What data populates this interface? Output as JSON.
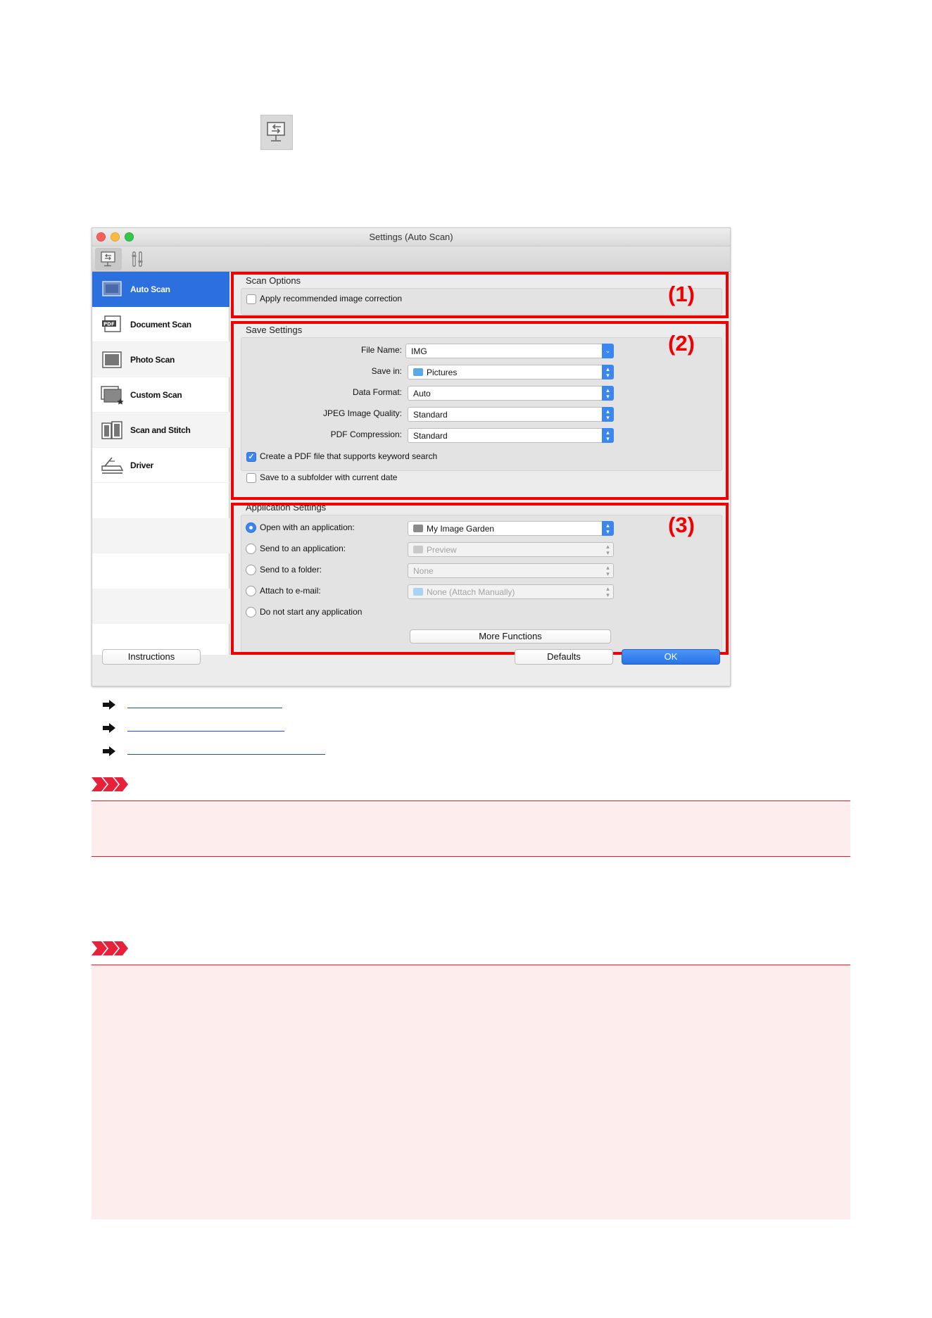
{
  "window": {
    "title": "Settings (Auto Scan)"
  },
  "sidebar": {
    "items": [
      {
        "label": "Auto Scan"
      },
      {
        "label": "Document Scan"
      },
      {
        "label": "Photo Scan"
      },
      {
        "label": "Custom Scan"
      },
      {
        "label": "Scan and Stitch"
      },
      {
        "label": "Driver"
      }
    ]
  },
  "scan_options": {
    "title": "Scan Options",
    "apply_correction_label": "Apply recommended image correction",
    "apply_correction_checked": false,
    "annotation": "(1)"
  },
  "save_settings": {
    "title": "Save Settings",
    "annotation": "(2)",
    "file_name_label": "File Name:",
    "file_name_value": "IMG",
    "save_in_label": "Save in:",
    "save_in_value": "Pictures",
    "data_format_label": "Data Format:",
    "data_format_value": "Auto",
    "jpeg_quality_label": "JPEG Image Quality:",
    "jpeg_quality_value": "Standard",
    "pdf_compression_label": "PDF Compression:",
    "pdf_compression_value": "Standard",
    "keyword_pdf_label": "Create a PDF file that supports keyword search",
    "keyword_pdf_checked": true,
    "subfolder_label": "Save to a subfolder with current date",
    "subfolder_checked": false
  },
  "application_settings": {
    "title": "Application Settings",
    "annotation": "(3)",
    "open_app_label": "Open with an application:",
    "open_app_value": "My Image Garden",
    "send_app_label": "Send to an application:",
    "send_app_value": "Preview",
    "send_folder_label": "Send to a folder:",
    "send_folder_value": "None",
    "attach_email_label": "Attach to e-mail:",
    "attach_email_value": "None (Attach Manually)",
    "no_app_label": "Do not start any application",
    "selected": "Open with an application:",
    "more_functions_label": "More Functions"
  },
  "footer": {
    "instructions_label": "Instructions",
    "defaults_label": "Defaults",
    "ok_label": "OK"
  },
  "colors": {
    "accent_blue": "#2c6fde",
    "annotation_red": "#f00000",
    "note_background": "#fdeded",
    "link_blue": "#1a4fd6"
  }
}
